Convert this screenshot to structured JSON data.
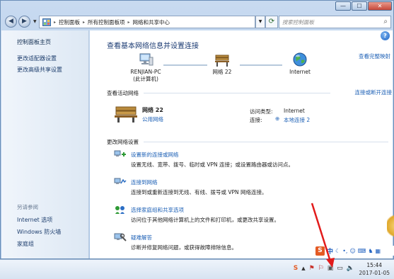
{
  "window": {
    "controls": {
      "minimize": "—",
      "maximize": "☐",
      "close": "✕"
    }
  },
  "address_bar": {
    "crumbs": [
      "控制面板",
      "所有控制面板项",
      "网络和共享中心"
    ],
    "search_placeholder": "搜索控制面板"
  },
  "left_pane": {
    "home": "控制面板主页",
    "links": [
      "更改适配器设置",
      "更改高级共享设置"
    ],
    "see_also_title": "另请参阅",
    "see_also": [
      "Internet 选项",
      "Windows 防火墙",
      "家庭组"
    ]
  },
  "main": {
    "title": "查看基本网络信息并设置连接",
    "view_full_map": "查看完整映射",
    "map": {
      "computer": {
        "line1": "RENJIAN-PC",
        "line2": "(此计算机)"
      },
      "network": "网络  22",
      "internet": "Internet"
    },
    "active_networks": {
      "heading": "查看活动网络",
      "connect_disconnect": "连接或断开连接",
      "network_name": "网络  22",
      "network_type": "公用网络",
      "access_type_label": "访问类型:",
      "access_type_value": "Internet",
      "connection_label": "连接:",
      "connection_value": "本地连接 2"
    },
    "change_settings": {
      "heading": "更改网络设置",
      "tasks": [
        {
          "title": "设置新的连接或网络",
          "desc": "设置无线、宽带、拨号、临时或 VPN 连接；或设置路由器或访问点。"
        },
        {
          "title": "连接到网络",
          "desc": "连接到或重新连接到无线、有线、拨号或 VPN 网络连接。"
        },
        {
          "title": "选择家庭组和共享选项",
          "desc": "访问位于其他网络计算机上的文件和打印机，或更改共享设置。"
        },
        {
          "title": "疑难解答",
          "desc": "诊断并修复网络问题，或获得故障排除信息。"
        }
      ]
    },
    "help_glyph": "?"
  },
  "ime_bar": {
    "lang": "中"
  },
  "taskbar": {
    "clock_time": "15:44",
    "clock_date": "2017-01-05"
  },
  "colors": {
    "link": "#1b5fb5",
    "title": "#1a3a72",
    "arrow": "#e21b1b"
  }
}
